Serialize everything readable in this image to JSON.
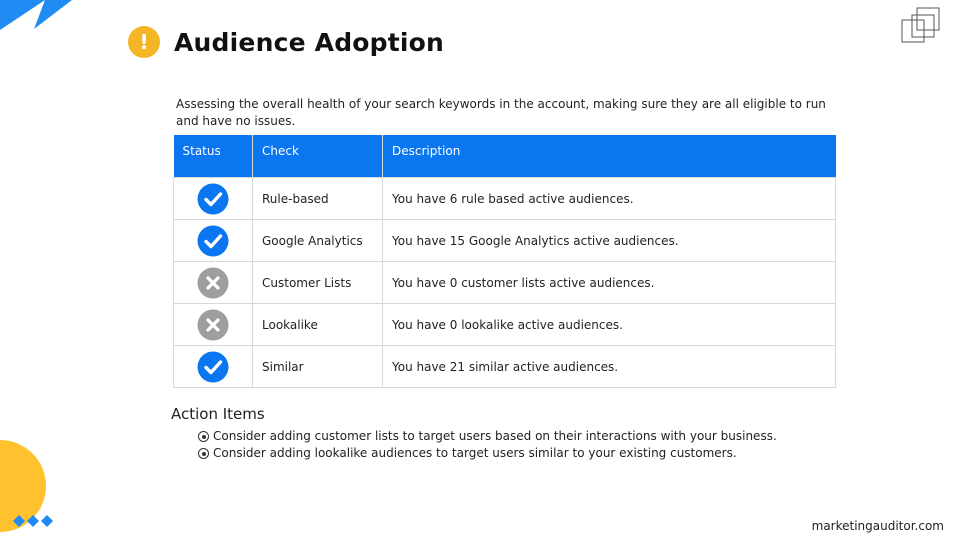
{
  "page": {
    "title": "Audience Adoption",
    "description": "Assessing the overall health of your search keywords in the account, making sure they are all eligible to run and have no issues.",
    "footer_text": "marketingauditor.com"
  },
  "table": {
    "headers": [
      "Status",
      "Check",
      "Description"
    ],
    "rows": [
      {
        "status": "pass",
        "check": "Rule-based",
        "description": "You have 6 rule based active audiences."
      },
      {
        "status": "pass",
        "check": "Google Analytics",
        "description": "You have 15 Google Analytics active audiences."
      },
      {
        "status": "fail",
        "check": "Customer Lists",
        "description": "You have 0 customer lists active audiences."
      },
      {
        "status": "fail",
        "check": "Lookalike",
        "description": "You have 0 lookalike active audiences."
      },
      {
        "status": "pass",
        "check": "Similar",
        "description": "You have 21 similar active audiences."
      }
    ]
  },
  "action_items": {
    "title": "Action Items",
    "items": [
      "Consider adding customer lists to target users based on their interactions with your business.",
      "Consider adding lookalike audiences to target users similar to your existing customers."
    ]
  },
  "icons": {
    "title_icon": "exclamation-icon",
    "pass_icon": "check-circle-icon",
    "fail_icon": "x-circle-icon"
  },
  "colors": {
    "accent_blue": "#0a76f0",
    "warning_yellow": "#f5b625",
    "decor_yellow": "#ffc22e",
    "fail_gray": "#9e9e9e"
  }
}
